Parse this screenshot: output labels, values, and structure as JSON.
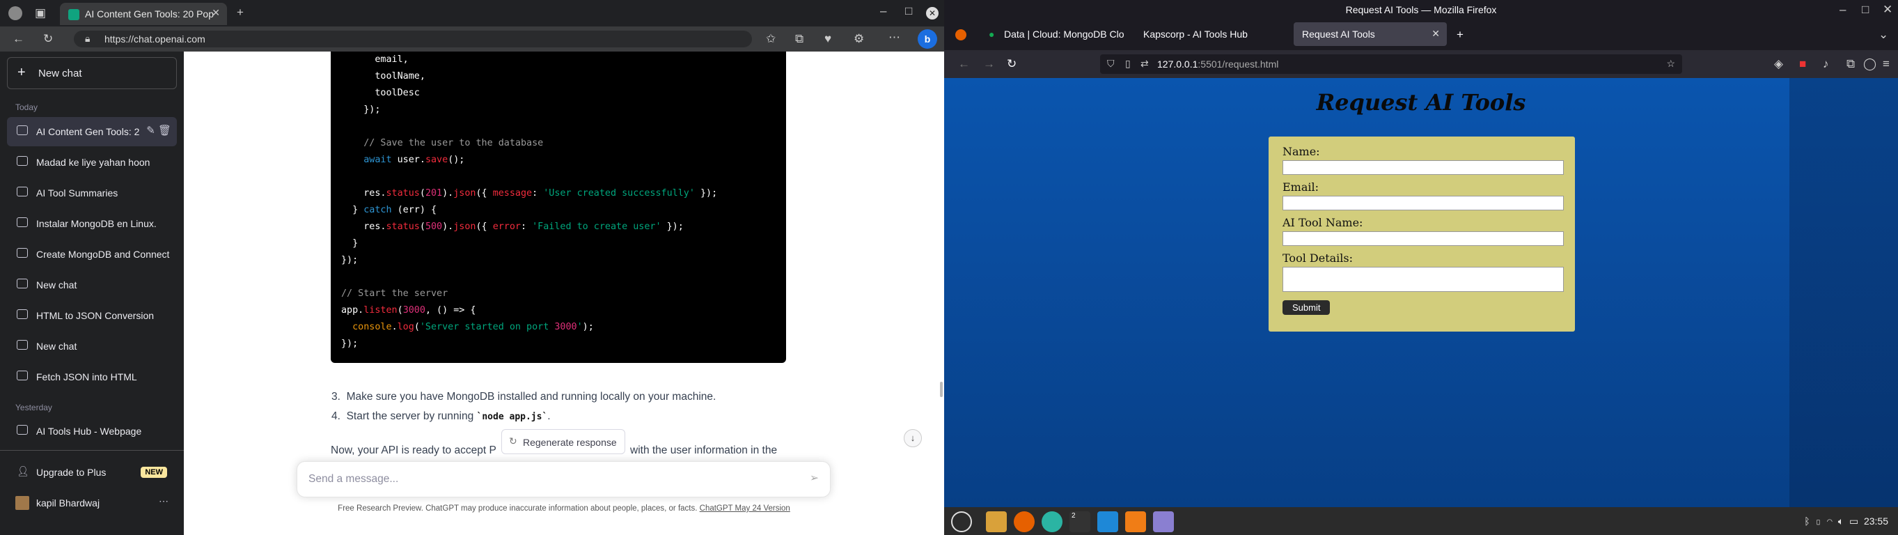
{
  "edge": {
    "tab_title": "AI Content Gen Tools: 20 Pop",
    "new_tab": "+",
    "url": "https://chat.openai.com"
  },
  "sidebar": {
    "new_chat": "New chat",
    "sections": [
      {
        "label": "Today",
        "items": [
          "AI Content Gen Tools: 2",
          "Madad ke liye yahan hoon",
          "AI Tool Summaries",
          "Instalar MongoDB en Linux.",
          "Create MongoDB and Connect",
          "New chat",
          "HTML to JSON Conversion",
          "New chat",
          "Fetch JSON into HTML"
        ]
      },
      {
        "label": "Yesterday",
        "items": [
          "AI Tools Hub - Webpage"
        ]
      }
    ],
    "upgrade": "Upgrade to Plus",
    "upgrade_badge": "NEW",
    "user": "kapil Bhardwaj"
  },
  "code_lines": [
    "      email,",
    "      toolName,",
    "      toolDesc",
    "    });",
    "",
    "    // Save the user to the database",
    "    await user.save();",
    "",
    "    res.status(201).json({ message: 'User created successfully' });",
    "  } catch (err) {",
    "    res.status(500).json({ error: 'Failed to create user' });",
    "  }",
    "});",
    "",
    "// Start the server",
    "app.listen(3000, () => {",
    "  console.log('Server started on port 3000');",
    "});"
  ],
  "steps": [
    {
      "num": "3.",
      "text": "Make sure you have MongoDB installed and running locally on your machine."
    },
    {
      "num": "4.",
      "pre": "Start the server by running ",
      "code": "`node app.js`",
      "post": "."
    }
  ],
  "partial_text_a": "Now, your API is ready to accept P",
  "partial_text_b": "with the user information in the",
  "regenerate": "Regenerate response",
  "send_placeholder": "Send a message...",
  "footer_text": "Free Research Preview. ChatGPT may produce inaccurate information about people, places, or facts. ",
  "footer_link": "ChatGPT May 24 Version",
  "firefox": {
    "window_title": "Request AI Tools — Mozilla Firefox",
    "tabs": [
      "Data | Cloud: MongoDB Clo",
      "Kapscorp - AI Tools Hub",
      "Request AI Tools"
    ],
    "url_host": "127.0.0.1",
    "url_rest": ":5501/request.html"
  },
  "page": {
    "title": "Request AI Tools",
    "fields": [
      "Name:",
      "Email:",
      "AI Tool Name:",
      "Tool Details:"
    ],
    "submit": "Submit"
  },
  "taskbar": {
    "clock": "23:55",
    "badge": "2"
  }
}
